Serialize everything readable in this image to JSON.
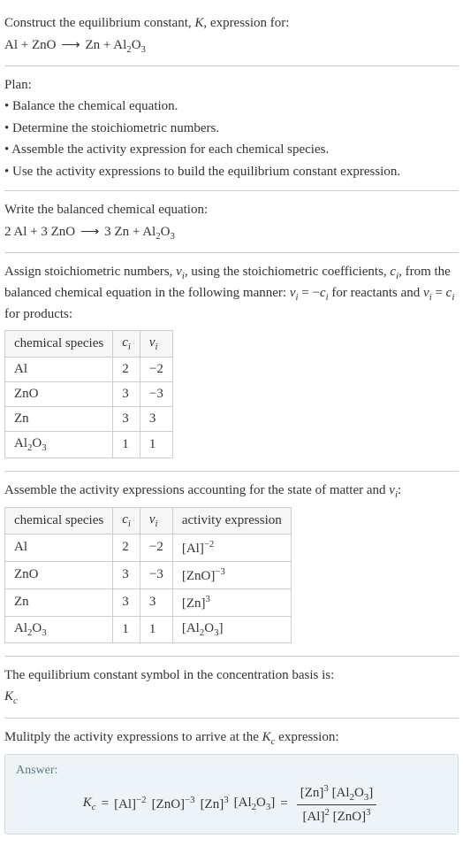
{
  "header": {
    "l1": "Construct the equilibrium constant, ",
    "K": "K",
    "l1b": ", expression for:",
    "eq_lhs": "Al + ZnO",
    "arrow": "⟶",
    "eq_rhs_a": "Zn + Al",
    "eq_rhs_sub": "2",
    "eq_rhs_b": "O",
    "eq_rhs_sub2": "3"
  },
  "plan": {
    "title": "Plan:",
    "b1": "• Balance the chemical equation.",
    "b2": "• Determine the stoichiometric numbers.",
    "b3": "• Assemble the activity expression for each chemical species.",
    "b4": "• Use the activity expressions to build the equilibrium constant expression."
  },
  "balanced": {
    "title": "Write the balanced chemical equation:",
    "lhs": "2 Al + 3 ZnO",
    "arrow": "⟶",
    "rhs_a": "3 Zn + Al",
    "rhs_sub": "2",
    "rhs_b": "O",
    "rhs_sub2": "3"
  },
  "assign": {
    "p1": "Assign stoichiometric numbers, ",
    "nu": "ν",
    "i": "i",
    "p2": ", using the stoichiometric coefficients, ",
    "c": "c",
    "p3": ", from the balanced chemical equation in the following manner: ",
    "rel1a": "ν",
    "rel1b": " = −",
    "rel1c": "c",
    "p4": " for reactants and ",
    "rel2a": "ν",
    "rel2b": " = ",
    "rel2c": "c",
    "p5": " for products:"
  },
  "table1": {
    "h1": "chemical species",
    "h2_a": "c",
    "h2_i": "i",
    "h3_a": "ν",
    "h3_i": "i",
    "r1c1": "Al",
    "r1c2": "2",
    "r1c3": "−2",
    "r2c1": "ZnO",
    "r2c2": "3",
    "r2c3": "−3",
    "r3c1": "Zn",
    "r3c2": "3",
    "r3c3": "3",
    "r4c1a": "Al",
    "r4c1s1": "2",
    "r4c1b": "O",
    "r4c1s2": "3",
    "r4c2": "1",
    "r4c3": "1"
  },
  "assemble": {
    "p1": "Assemble the activity expressions accounting for the state of matter and ",
    "nu": "ν",
    "i": "i",
    "p2": ":"
  },
  "table2": {
    "h1": "chemical species",
    "h2_a": "c",
    "h2_i": "i",
    "h3_a": "ν",
    "h3_i": "i",
    "h4": "activity expression",
    "r1c1": "Al",
    "r1c2": "2",
    "r1c3": "−2",
    "r1c4a": "[Al]",
    "r1c4e": "−2",
    "r2c1": "ZnO",
    "r2c2": "3",
    "r2c3": "−3",
    "r2c4a": "[ZnO]",
    "r2c4e": "−3",
    "r3c1": "Zn",
    "r3c2": "3",
    "r3c3": "3",
    "r3c4a": "[Zn]",
    "r3c4e": "3",
    "r4c1a": "Al",
    "r4c1s1": "2",
    "r4c1b": "O",
    "r4c1s2": "3",
    "r4c2": "1",
    "r4c3": "1",
    "r4c4a": "[Al",
    "r4c4s1": "2",
    "r4c4b": "O",
    "r4c4s2": "3",
    "r4c4c": "]"
  },
  "symbol": {
    "p1": "The equilibrium constant symbol in the concentration basis is:",
    "K": "K",
    "c": "c"
  },
  "multiply": {
    "p1": "Mulitply the activity expressions to arrive at the ",
    "K": "K",
    "c": "c",
    "p2": " expression:"
  },
  "answer": {
    "label": "Answer:",
    "Kc_K": "K",
    "Kc_c": "c",
    "eq": " = ",
    "t1a": "[Al]",
    "t1e": "−2",
    "t2a": "[ZnO]",
    "t2e": "−3",
    "t3a": "[Zn]",
    "t3e": "3",
    "t4a": "[Al",
    "t4s1": "2",
    "t4b": "O",
    "t4s2": "3",
    "t4c": "]",
    "eq2": " = ",
    "num_a": "[Zn]",
    "num_e": "3",
    "num_b": "[Al",
    "num_s1": "2",
    "num_c": "O",
    "num_s2": "3",
    "num_d": "]",
    "den_a": "[Al]",
    "den_ae": "2",
    "den_b": "[ZnO]",
    "den_be": "3"
  }
}
